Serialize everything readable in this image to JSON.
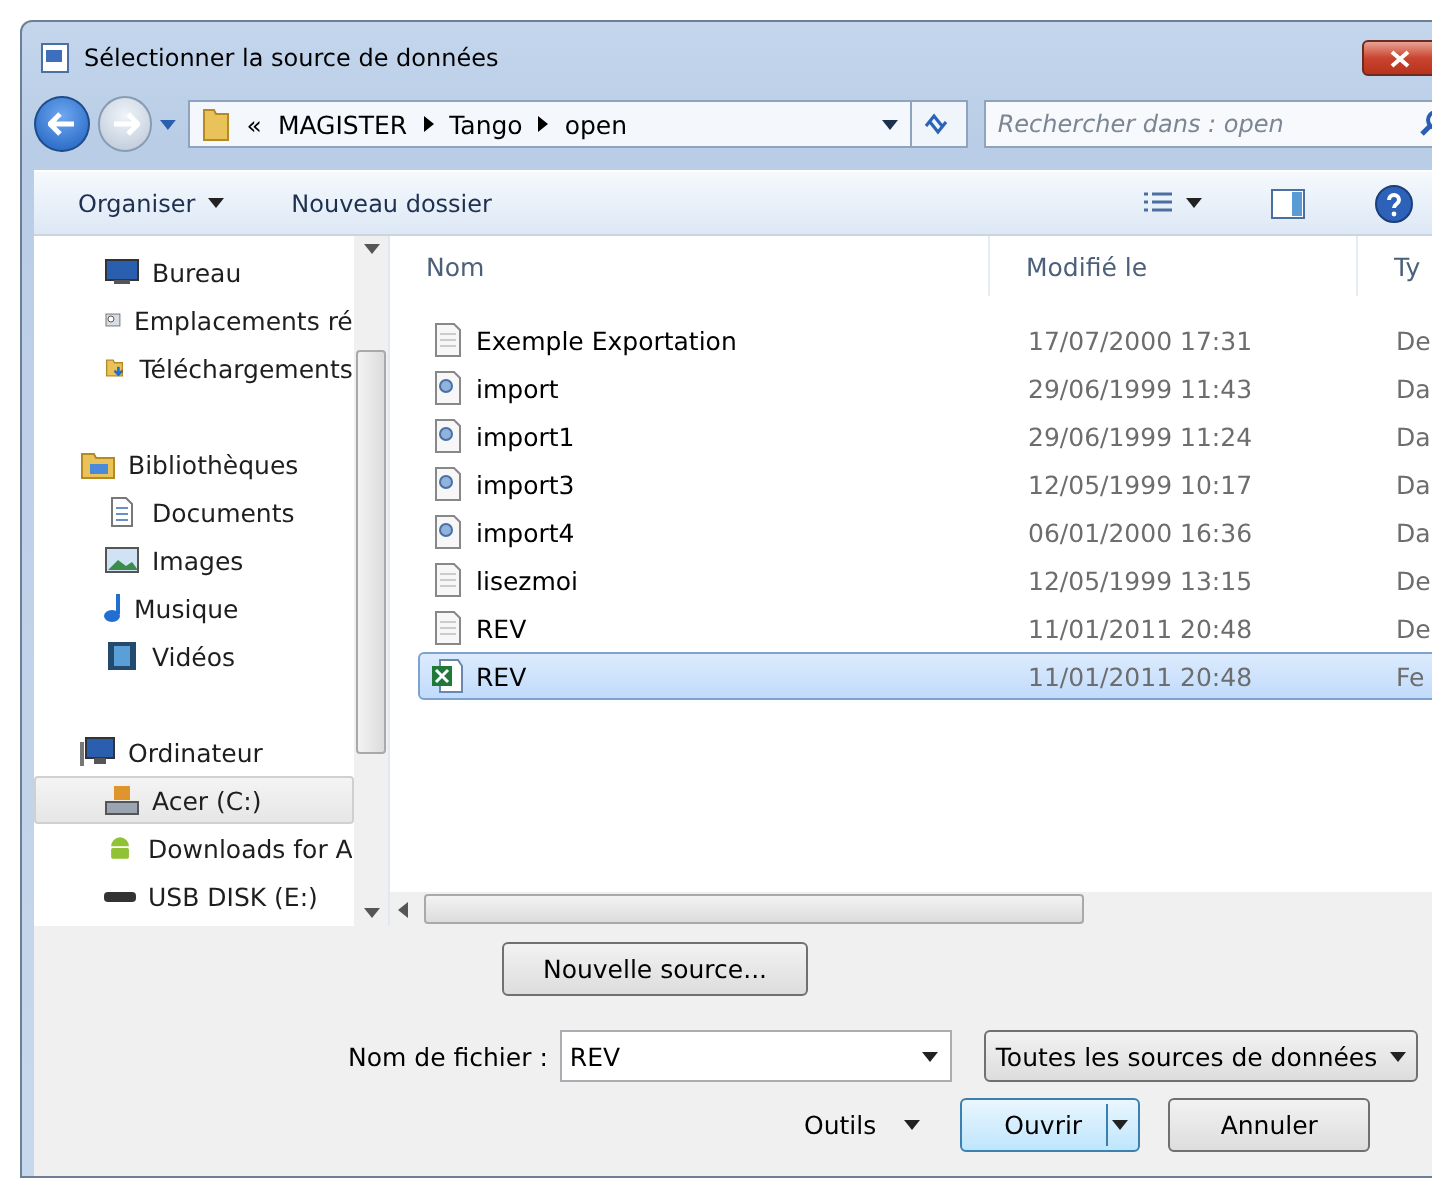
{
  "window": {
    "title": "Sélectionner la source de données"
  },
  "address": {
    "overflow": "«",
    "path": [
      "MAGISTER",
      "Tango",
      "open"
    ]
  },
  "search": {
    "placeholder": "Rechercher dans : open"
  },
  "toolbar": {
    "organize": "Organiser",
    "new_folder": "Nouveau dossier"
  },
  "nav": [
    {
      "label": "Bureau",
      "kind": "desktop",
      "group": false,
      "selected": false
    },
    {
      "label": "Emplacements ré",
      "kind": "recent",
      "group": false,
      "selected": false
    },
    {
      "label": "Téléchargements",
      "kind": "download",
      "group": false,
      "selected": false
    },
    {
      "label": "Bibliothèques",
      "kind": "library",
      "group": true,
      "selected": false
    },
    {
      "label": "Documents",
      "kind": "document",
      "group": false,
      "selected": false
    },
    {
      "label": "Images",
      "kind": "image",
      "group": false,
      "selected": false
    },
    {
      "label": "Musique",
      "kind": "music",
      "group": false,
      "selected": false
    },
    {
      "label": "Vidéos",
      "kind": "video",
      "group": false,
      "selected": false
    },
    {
      "label": "Ordinateur",
      "kind": "computer",
      "group": true,
      "selected": false
    },
    {
      "label": "Acer (C:)",
      "kind": "drive",
      "group": false,
      "selected": true
    },
    {
      "label": "Downloads for A",
      "kind": "android",
      "group": false,
      "selected": false
    },
    {
      "label": "USB DISK (E:)",
      "kind": "usb",
      "group": false,
      "selected": false
    }
  ],
  "table": {
    "columns": [
      "Nom",
      "Modifié le",
      "Ty"
    ],
    "rows": [
      {
        "name": "Exemple Exportation",
        "modified": "17/07/2000 17:31",
        "column_3": "De",
        "kind": "text",
        "selected": false
      },
      {
        "name": "import",
        "modified": "29/06/1999 11:43",
        "column_3": "Da",
        "kind": "config",
        "selected": false
      },
      {
        "name": "import1",
        "modified": "29/06/1999 11:24",
        "column_3": "Da",
        "kind": "config",
        "selected": false
      },
      {
        "name": "import3",
        "modified": "12/05/1999 10:17",
        "column_3": "Da",
        "kind": "config",
        "selected": false
      },
      {
        "name": "import4",
        "modified": "06/01/2000 16:36",
        "column_3": "Da",
        "kind": "config",
        "selected": false
      },
      {
        "name": "lisezmoi",
        "modified": "12/05/1999 13:15",
        "column_3": "De",
        "kind": "text",
        "selected": false
      },
      {
        "name": "REV",
        "modified": "11/01/2011 20:48",
        "column_3": "De",
        "kind": "text",
        "selected": false
      },
      {
        "name": "REV",
        "modified": "11/01/2011 20:48",
        "column_3": "Fe",
        "kind": "sheet",
        "selected": true
      }
    ]
  },
  "new_source_button": "Nouvelle source...",
  "filename": {
    "label": "Nom de fichier :",
    "value": "REV"
  },
  "filter": "Toutes les sources de données",
  "tools": "Outils",
  "buttons": {
    "open": "Ouvrir",
    "cancel": "Annuler"
  }
}
